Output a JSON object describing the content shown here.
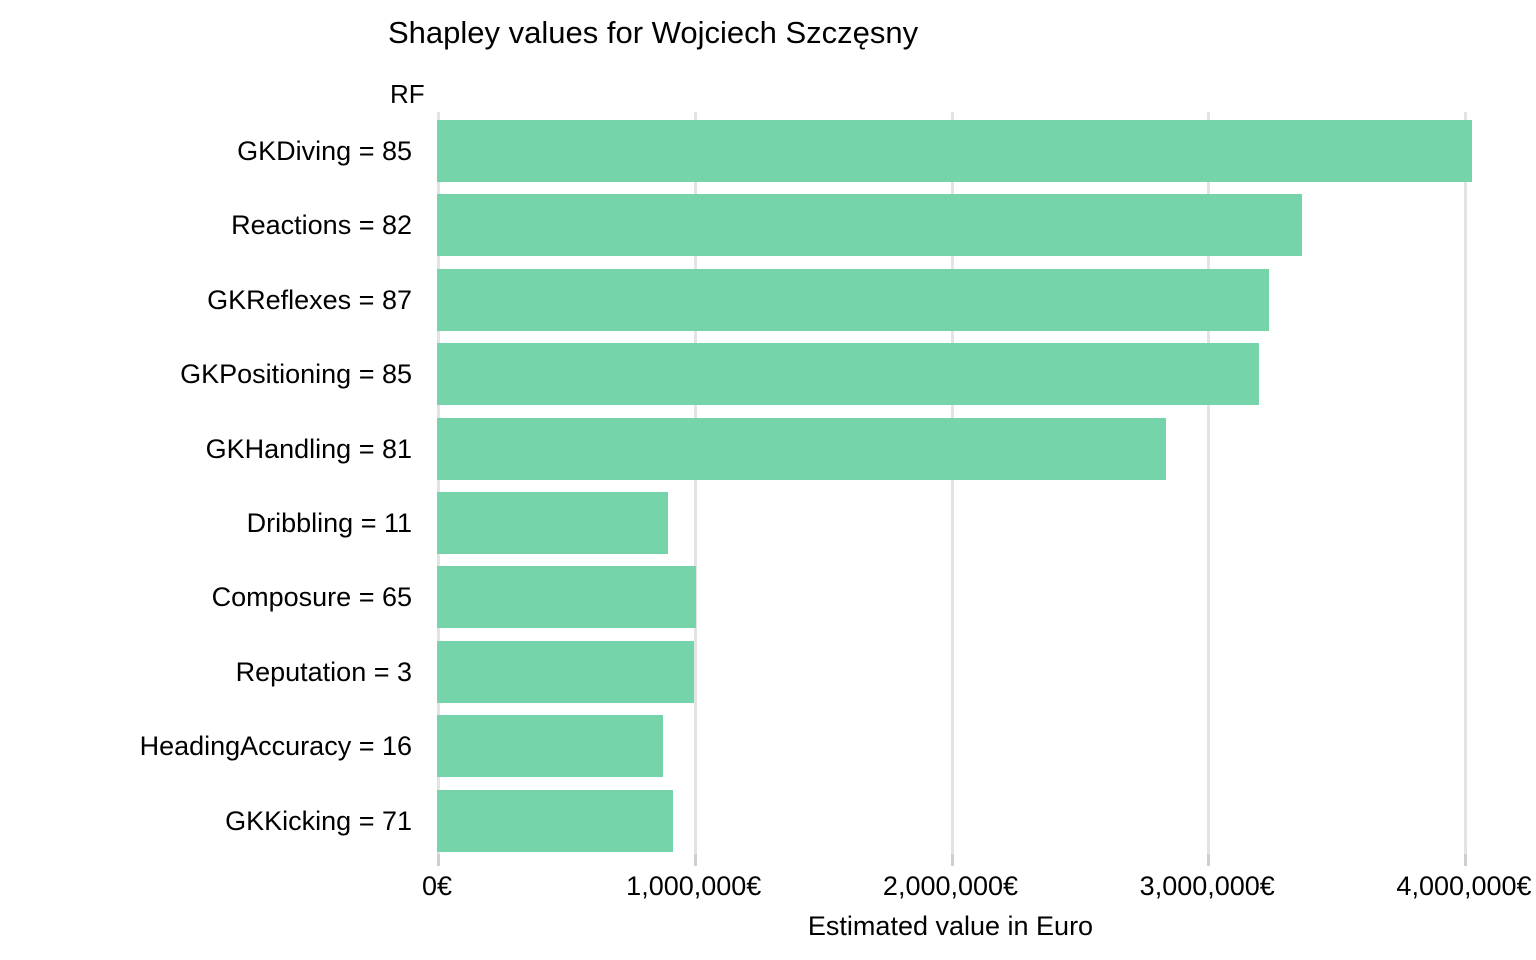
{
  "chart_data": {
    "type": "bar",
    "orientation": "horizontal",
    "title": "Shapley values for Wojciech Szczęsny",
    "panel_label": "RF",
    "xlabel": "Estimated value in Euro",
    "ylabel": "",
    "grid": true,
    "legend": null,
    "xlim": [
      0,
      4200000
    ],
    "xticks": [
      0,
      1000000,
      2000000,
      3000000,
      4000000
    ],
    "xtick_labels": [
      "0€",
      "1,000,000€",
      "2,000,000€",
      "3,000,000€",
      "4,000,000€"
    ],
    "bar_color": "#76d4ab",
    "grid_color": "#e3e3e3",
    "background_color": "#ffffff",
    "categories": [
      "GKDiving = 85",
      "Reactions = 82",
      "GKReflexes = 87",
      "GKPositioning = 85",
      "GKHandling = 81",
      "Dribbling = 11",
      "Composure = 65",
      "Reputation = 3",
      "HeadingAccuracy = 16",
      "GKKicking = 71"
    ],
    "values": [
      4030000,
      3370000,
      3240000,
      3200000,
      2840000,
      900000,
      1010000,
      1000000,
      880000,
      920000
    ],
    "series": [
      {
        "name": "RF",
        "values": [
          4030000,
          3370000,
          3240000,
          3200000,
          2840000,
          900000,
          1010000,
          1000000,
          880000,
          920000
        ]
      }
    ]
  }
}
